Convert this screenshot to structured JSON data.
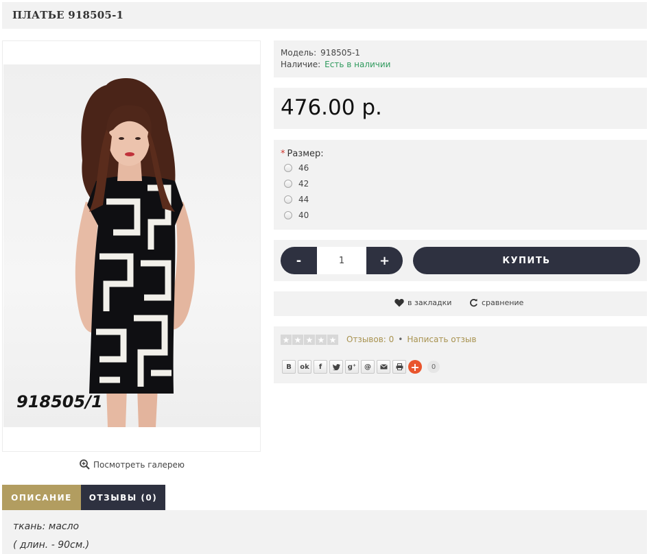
{
  "product": {
    "title": "ПЛАТЬЕ 918505-1",
    "photo_code": "918505/1"
  },
  "gallery": {
    "label": "Посмотреть галерею",
    "icon": "zoom-in-icon"
  },
  "info": {
    "model_label": "Модель:",
    "model_value": "918505-1",
    "availability_label": "Наличие:",
    "availability_value": "Есть в наличии",
    "availability_color": "#2f9a5d"
  },
  "price": "476.00 р.",
  "size": {
    "required_mark": "*",
    "label": "Размер:",
    "options": [
      "46",
      "42",
      "44",
      "40"
    ]
  },
  "buy": {
    "minus": "-",
    "plus": "+",
    "quantity": "1",
    "button": "КУПИТЬ"
  },
  "actions": {
    "wishlist": "в закладки",
    "compare": "сравнение"
  },
  "reviews": {
    "rating": 0,
    "max_rating": 5,
    "count_label": "Отзывов: 0",
    "separator": "•",
    "write_label": "Написать отзыв"
  },
  "share": {
    "buttons": [
      "В",
      "ok",
      "f",
      "twitter",
      "g+",
      "@",
      "mail",
      "print"
    ],
    "count": "0"
  },
  "tabs": {
    "description": "ОПИСАНИЕ",
    "reviews": "ОТЗЫВЫ (0)"
  },
  "description": {
    "line1": "ткань: масло",
    "line2": "( длин. - 90см.)"
  },
  "colors": {
    "dark": "#2e3140",
    "gold": "#b29d60",
    "panel": "#f2f2f2",
    "link": "#a8924f"
  }
}
